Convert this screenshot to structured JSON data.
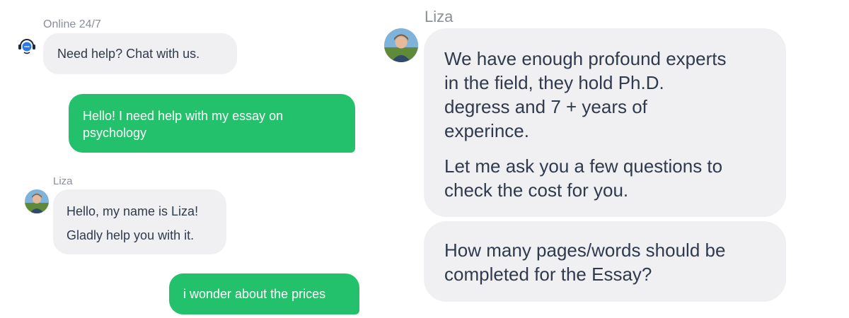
{
  "left_chat": {
    "header": {
      "status": "Online 24/7",
      "icon": "support-chat-icon"
    },
    "welcome_message": "Need help? Chat with us.",
    "user_message_1": {
      "lines": [
        "Hello! I need help with my essay on",
        "psychology"
      ],
      "color": "#23c16b"
    },
    "agent_block": {
      "name": "Liza",
      "lines": [
        "Hello, my name is Liza!",
        "Gladly help you with it."
      ]
    },
    "user_message_2": {
      "text": "i wonder about the prices",
      "color": "#23c16b"
    }
  },
  "right_chat": {
    "agent_name": "Liza",
    "message_1": {
      "paragraph_1": [
        "We have enough profound experts",
        "in the field, they hold Ph.D.",
        "degress and 7 + years of",
        "experince."
      ],
      "paragraph_2": [
        "Let me ask you a few questions to",
        "check the cost for you."
      ]
    },
    "message_2": {
      "lines": [
        "How many pages/words should be",
        "completed for the Essay?"
      ]
    }
  },
  "colors": {
    "agent_bubble": "#f0f0f2",
    "user_bubble": "#23c16b",
    "agent_text": "#2f3a4d",
    "meta_text": "#8a8f98",
    "support_icon_blue": "#2c7be5"
  }
}
